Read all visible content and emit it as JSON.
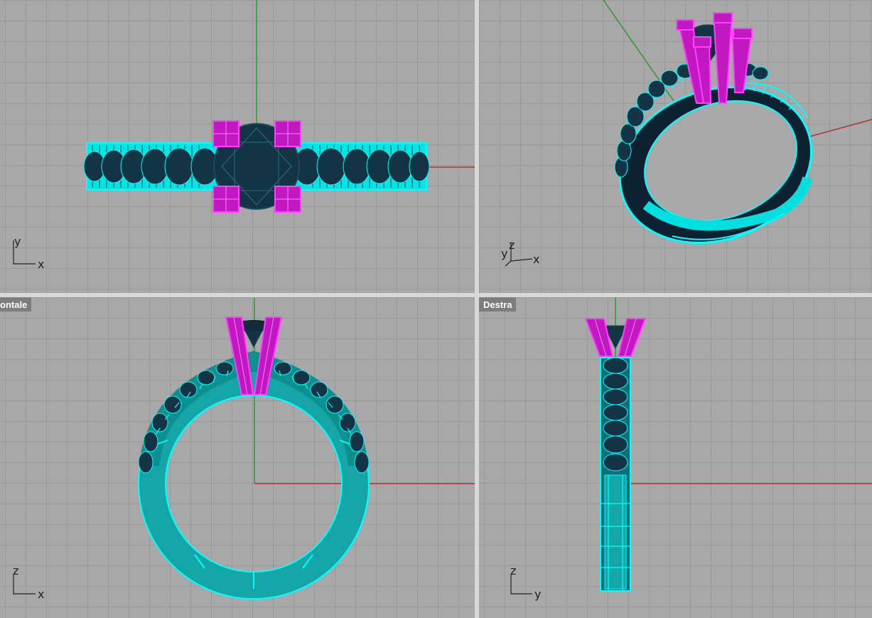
{
  "colors": {
    "viewport_bg": "#a8a8a8",
    "grid_line": "#989898",
    "x_axis": "#b03030",
    "y_axis": "#2e9a2e",
    "band": "#00ffff",
    "band_shade": "#0a8c8c",
    "stone": "#102c3c",
    "prong": "#e21fe2",
    "label_bg": "#7d7d7d"
  },
  "viewports": {
    "top": {
      "label": "",
      "axis_a": "y",
      "axis_b": "x"
    },
    "perspective": {
      "label": "",
      "axis_a": "z",
      "axis_b": "y",
      "axis_c": "x"
    },
    "front": {
      "label": "ontale",
      "axis_a": "z",
      "axis_b": "x"
    },
    "right": {
      "label": "Destra",
      "axis_a": "z",
      "axis_b": "y"
    }
  }
}
